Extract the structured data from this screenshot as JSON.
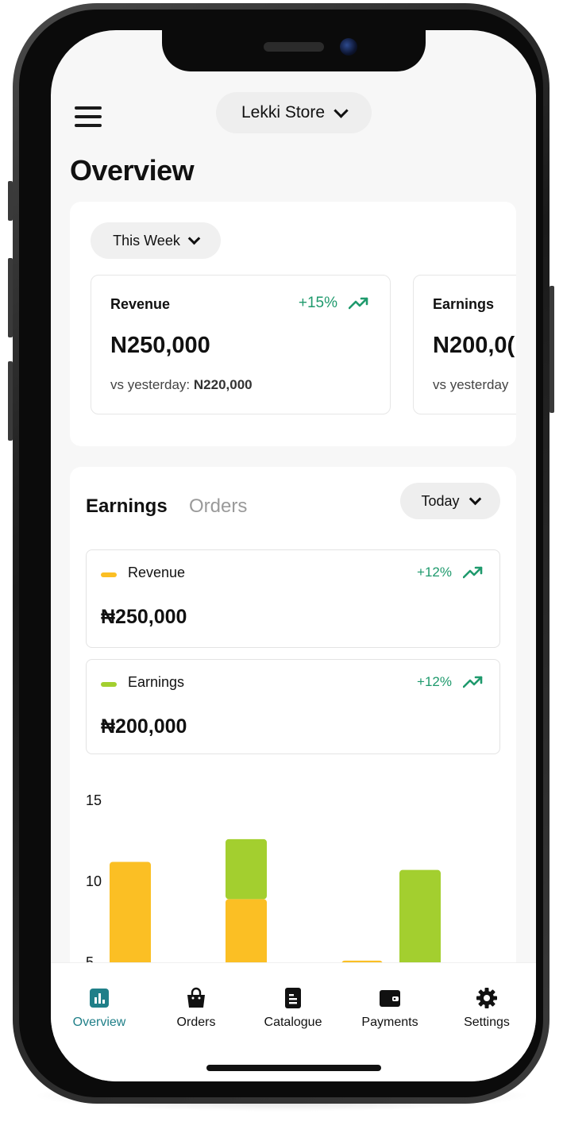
{
  "header": {
    "store_name": "Lekki Store",
    "page_title": "Overview"
  },
  "summary": {
    "period_label": "This Week",
    "cards": [
      {
        "label": "Revenue",
        "change": "+15%",
        "value": "N250,000",
        "compare_prefix": "vs yesterday:",
        "compare_value": "N220,000"
      },
      {
        "label": "Earnings",
        "change": "",
        "value": "N200,0(",
        "compare_prefix": "vs yesterday",
        "compare_value": ""
      }
    ]
  },
  "earnings": {
    "tabs": [
      "Earnings",
      "Orders"
    ],
    "active_tab": "Earnings",
    "period_label": "Today",
    "metrics": [
      {
        "label": "Revenue",
        "change": "+12%",
        "value": "₦250,000",
        "color": "#fbbf24"
      },
      {
        "label": "Earnings",
        "change": "+12%",
        "value": "₦200,000",
        "color": "#a3cf2f"
      }
    ]
  },
  "chart_data": {
    "type": "bar",
    "stacked": true,
    "y_ticks": [
      "15",
      "10",
      "5"
    ],
    "ylim": [
      5,
      15
    ],
    "series": [
      {
        "name": "Revenue",
        "color": "#fbbf24",
        "values": [
          11.3,
          0,
          9.0,
          0,
          5.2,
          0
        ]
      },
      {
        "name": "Earnings",
        "color": "#a3cf2f",
        "values": [
          0,
          0,
          3.7,
          5.1,
          0,
          10.8
        ]
      }
    ]
  },
  "nav": {
    "items": [
      {
        "label": "Overview",
        "icon": "bar-chart-icon",
        "active": true
      },
      {
        "label": "Orders",
        "icon": "shopping-bag-icon",
        "active": false
      },
      {
        "label": "Catalogue",
        "icon": "document-icon",
        "active": false
      },
      {
        "label": "Payments",
        "icon": "wallet-icon",
        "active": false
      },
      {
        "label": "Settings",
        "icon": "gear-icon",
        "active": false
      }
    ],
    "active_color": "#1f7f88"
  }
}
